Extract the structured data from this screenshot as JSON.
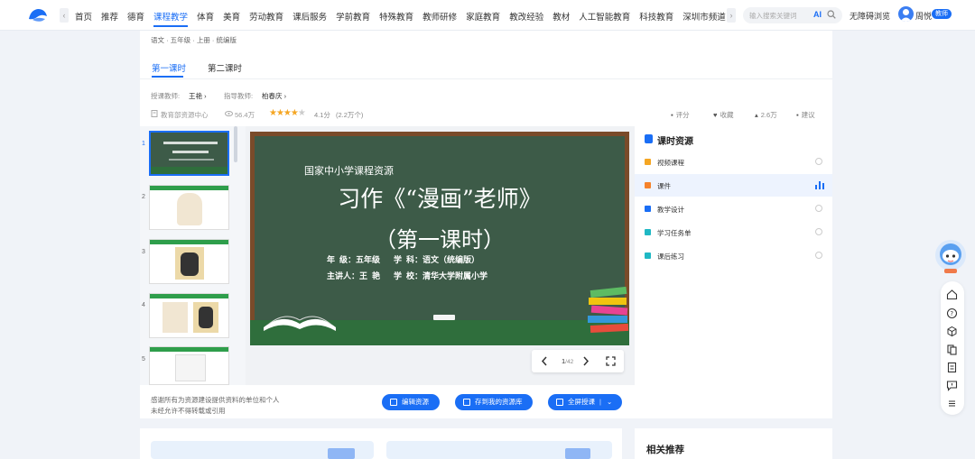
{
  "nav": {
    "items": [
      "首页",
      "推荐",
      "德育",
      "课程教学",
      "体育",
      "美育",
      "劳动教育",
      "课后服务",
      "学前教育",
      "特殊教育",
      "教师研修",
      "家庭教育",
      "教改经验",
      "教材",
      "人工智能教育",
      "科技教育",
      "深圳市频道"
    ],
    "active_index": 3,
    "search_placeholder": "输入搜索关键词",
    "ai_label": "AI",
    "accessibility": "无障碍浏览",
    "user_name": "周悦",
    "user_badge": "教师"
  },
  "course": {
    "breadcrumb": "语文 · 五年级 · 上册 · 统编版",
    "tabs": [
      "第一课时",
      "第二课时"
    ],
    "teacher_label": "授课教师:",
    "teacher_name": "王艳 ›",
    "guide_label": "指导教师:",
    "guide_name": "柏春庆 ›",
    "source": "教育部资源中心",
    "views": "56.4万",
    "rating": 4.1,
    "rating_text": "4.1分",
    "rating_count": "(2.2万个)",
    "actions": {
      "rate": "评分",
      "favorite": "收藏",
      "like": "2.6万",
      "suggest": "建议"
    }
  },
  "thumbnails": [
    "1",
    "2",
    "3",
    "4",
    "5"
  ],
  "slide": {
    "source_text": "国家中小学课程资源",
    "title": "习作《“漫画”老师》",
    "subtitle": "（第一课时）",
    "line1": "年  级：五年级      学  科：语文（统编版）",
    "line2": "主讲人：王  艳      学  校：清华大学附属小学",
    "page_current": "1",
    "page_total": "/42"
  },
  "footer": {
    "thanks_line1": "感谢所有为资源建设提供资料的单位和个人",
    "thanks_line2": "未经允许不得转载或引用",
    "edit_button": "编辑资源",
    "save_button": "存到我的资源库",
    "fullscreen_button": "全屏授课"
  },
  "resources": {
    "title": "课时资源",
    "items": [
      {
        "label": "视频课程",
        "color": "#f5a623"
      },
      {
        "label": "课件",
        "color": "#f5822a"
      },
      {
        "label": "教学设计",
        "color": "#1a6ef5"
      },
      {
        "label": "学习任务单",
        "color": "#1fb8c4"
      },
      {
        "label": "课后练习",
        "color": "#1fb8c4"
      }
    ],
    "selected_index": 1
  },
  "related": {
    "title": "相关推荐"
  }
}
